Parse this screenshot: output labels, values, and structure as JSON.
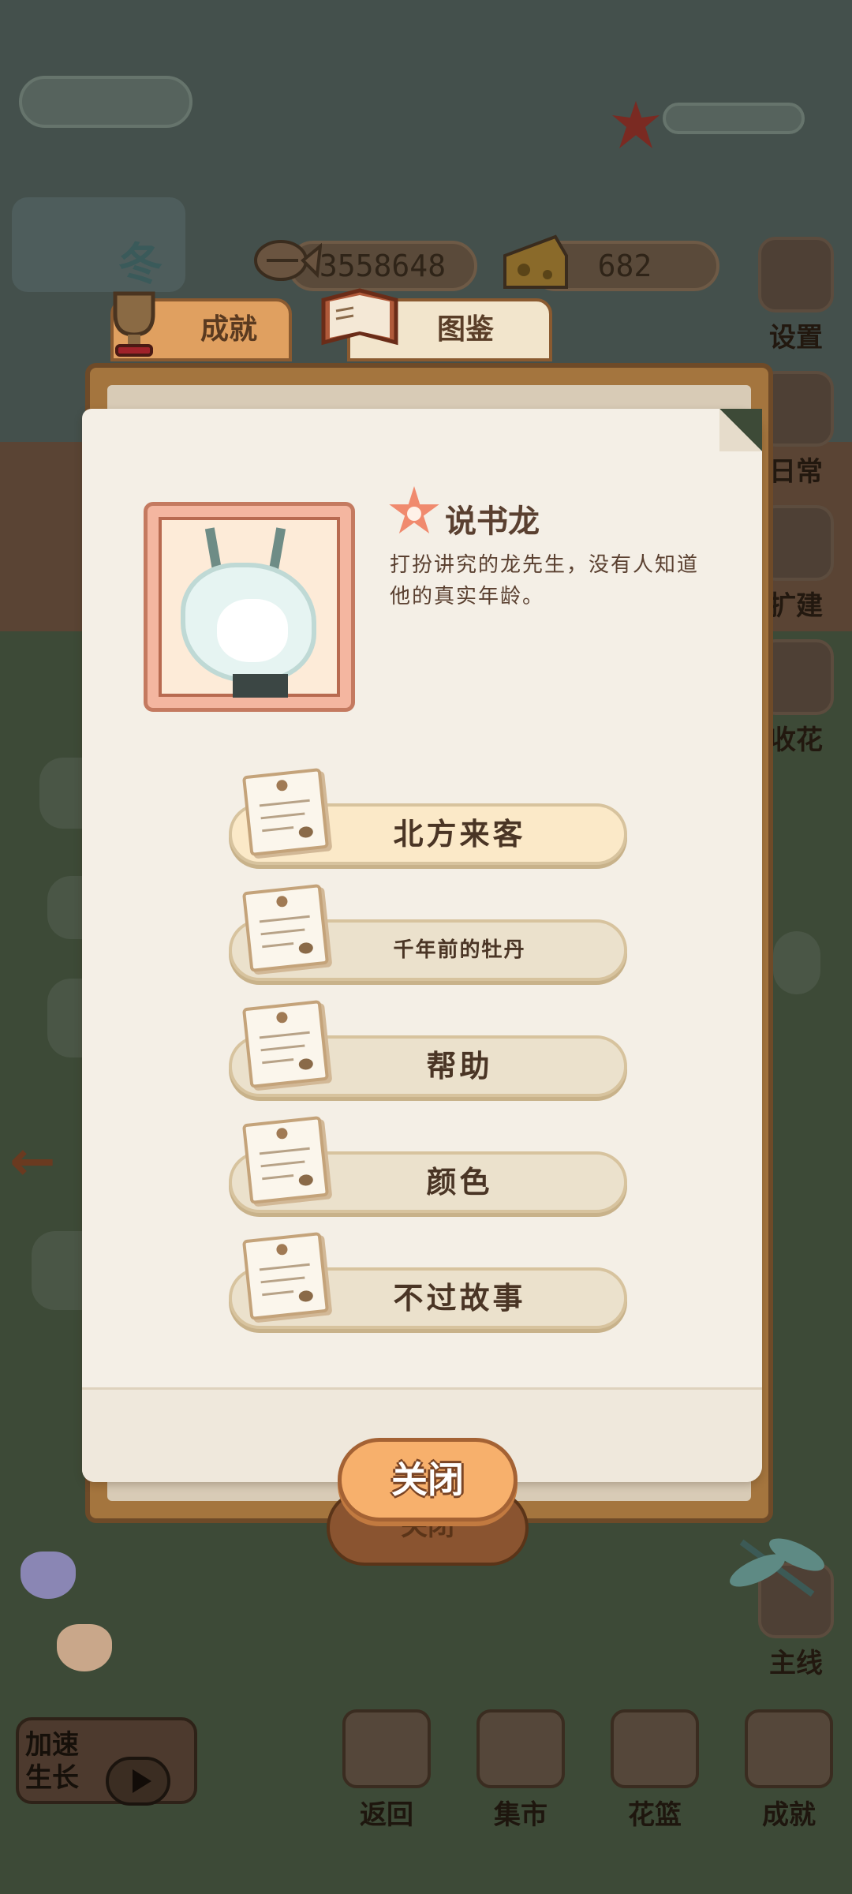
{
  "season": {
    "label": "冬"
  },
  "currency": {
    "fish": {
      "icon": "fish-bone-icon",
      "value": "3558648"
    },
    "cheese": {
      "icon": "cheese-icon",
      "value": "682"
    }
  },
  "side_menu": {
    "settings": {
      "icon": "gear-icon",
      "label": "设置"
    },
    "daily": {
      "icon": "scroll-icon",
      "label": "日常"
    },
    "build": {
      "icon": "hammer-icon",
      "label": "扩建"
    },
    "flower": {
      "icon": "rose-icon",
      "label": "收花"
    },
    "mainline": {
      "icon": "book-icon",
      "label": "主线"
    }
  },
  "tabs": [
    {
      "icon": "trophy-icon",
      "label": "成就"
    },
    {
      "icon": "open-book-icon",
      "label": "图鉴"
    }
  ],
  "character": {
    "icon": "flower-icon",
    "name": "说书龙",
    "description": "打扮讲究的龙先生，没有人知道他的真实年龄。"
  },
  "stories": [
    {
      "icon": "note-paper-icon",
      "label": "北方来客"
    },
    {
      "icon": "note-paper-icon",
      "label": "千年前的牡丹"
    },
    {
      "icon": "note-paper-icon",
      "label": "帮助"
    },
    {
      "icon": "note-paper-icon",
      "label": "颜色"
    },
    {
      "icon": "note-paper-icon",
      "label": "不过故事"
    }
  ],
  "close_button": {
    "label": "关闭"
  },
  "background_close": {
    "label": "关闭"
  },
  "speed_up": {
    "label_line1": "加速",
    "label_line2": "生长",
    "icon": "play-icon"
  },
  "bottom_nav": [
    {
      "icon": "window-icon",
      "label": "返回"
    },
    {
      "icon": "market-stall-icon",
      "label": "集市"
    },
    {
      "icon": "flower-basket-icon",
      "label": "花篮"
    },
    {
      "icon": "trophy-icon",
      "label": "成就"
    }
  ],
  "colors": {
    "accent": "#f7b06c",
    "paper": "#f4efe6",
    "frame": "#a4753e",
    "text": "#5a4030"
  }
}
